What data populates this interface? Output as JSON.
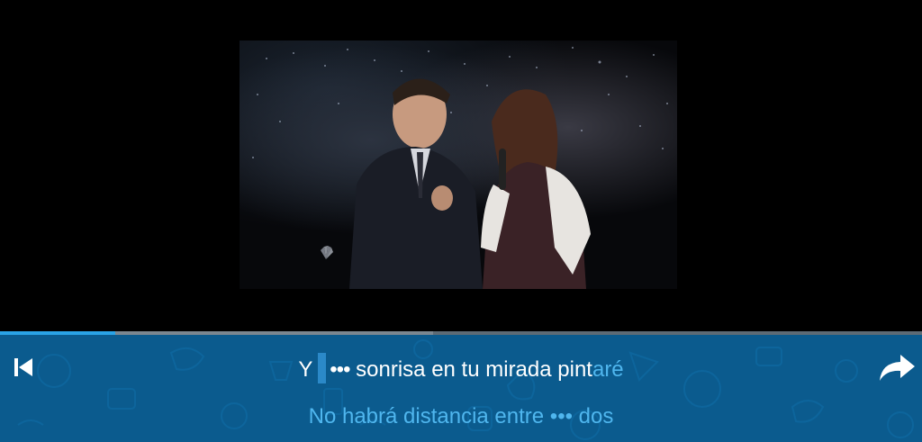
{
  "player": {
    "progress_fraction": 0.125,
    "buffered_fraction": 0.47
  },
  "lyrics": {
    "current": {
      "word_before": "Y",
      "ellipsis": "•••",
      "sung": "sonrisa en tu mirada pint",
      "upcoming": "aré"
    },
    "next_line": "No habrá distancia entre ••• dos"
  },
  "icons": {
    "back": "skip-previous-icon",
    "share": "share-arrow-icon"
  },
  "colors": {
    "panel": "#0b5b8e",
    "progress": "#2aa3e6",
    "upcoming_text": "#4fb6ee"
  }
}
